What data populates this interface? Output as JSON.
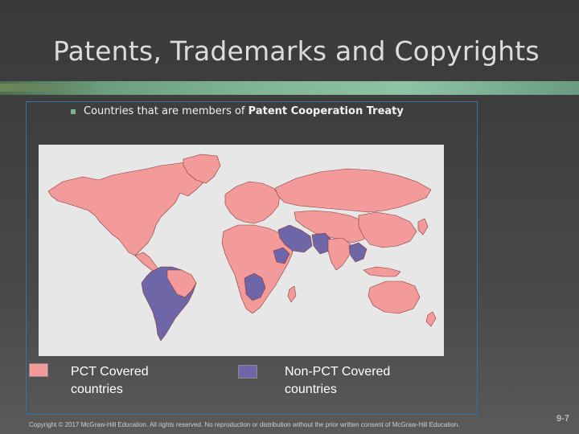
{
  "slide": {
    "title": "Patents, Trademarks and Copyrights",
    "bullet_prefix": "Countries that are members of ",
    "bullet_bold": "Patent Cooperation Treaty",
    "page_number": "9-7",
    "copyright": "Copyright © 2017 McGraw-Hill Education. All rights reserved. No reproduction or distribution without the prior written consent of McGraw-Hill Education."
  },
  "legend": {
    "pct": {
      "label_line1": "PCT Covered",
      "label_line2": "countries",
      "color": "#f39a9a"
    },
    "non_pct": {
      "label_line1": "Non-PCT Covered",
      "label_line2": "countries",
      "color": "#6e66a6"
    }
  },
  "map": {
    "background_color": "#e7e7e7",
    "pct_color": "#f39a9a",
    "non_pct_color": "#6e66a6",
    "border_color": "#8a3838"
  }
}
